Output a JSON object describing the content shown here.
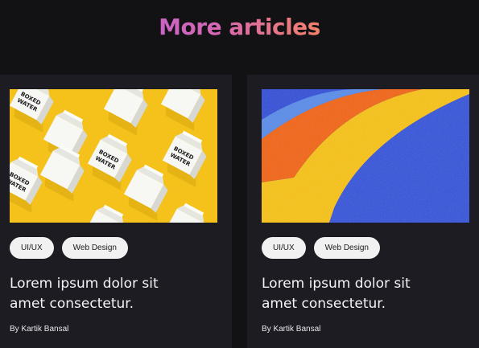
{
  "section": {
    "title": "More articles"
  },
  "articles": [
    {
      "image": "boxed-water-cartons-on-yellow",
      "carton_text": [
        "BOXED",
        "WATER"
      ],
      "tags": [
        "UI/UX",
        "Web Design"
      ],
      "title_line1": "Lorem ipsum dolor sit",
      "title_line2": "amet consectetur.",
      "byline": "By Kartik Bansal"
    },
    {
      "image": "colorful-arch-stripes-on-blue",
      "tags": [
        "UI/UX",
        "Web Design"
      ],
      "title_line1": "Lorem ipsum dolor sit",
      "title_line2": "amet consectetur.",
      "byline": "By Kartik Bansal"
    }
  ],
  "colors": {
    "background": "#121214",
    "card": "#1d1c22",
    "title_gradient_start": "#a65cf0",
    "title_gradient_end": "#ffa23e",
    "tag_background": "#f1f1f1",
    "yellow": "#f4c21a",
    "blue": "#3b56d6",
    "orange": "#ef6a1c"
  }
}
